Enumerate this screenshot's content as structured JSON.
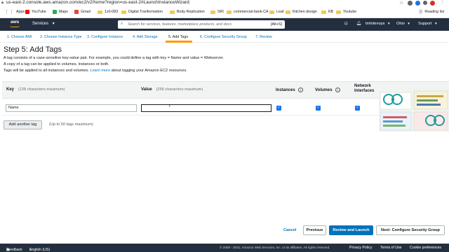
{
  "browser": {
    "url": "us-east-2.console.aws.amazon.com/ec2/v2/home?region=us-east-2#LaunchInstanceWizard:",
    "bookmarks": [
      {
        "label": "Apps",
        "icon": "apps-grid-icon",
        "color": "#5f6368"
      },
      {
        "label": "YouTube",
        "icon": "youtube-icon",
        "color": "#ff0000"
      },
      {
        "label": "Maps",
        "icon": "maps-icon",
        "color": "#34a853"
      },
      {
        "label": "Gmail",
        "icon": "gmail-icon",
        "color": "#ea4335"
      },
      {
        "label": "1z0-083",
        "icon": "folder-icon",
        "color": "#f2c94c"
      },
      {
        "label": "Digital Tranformation",
        "icon": "folder-icon",
        "color": "#f2c94c"
      },
      {
        "label": "Body Replication",
        "icon": "folder-icon",
        "color": "#f2c94c"
      },
      {
        "label": "SRI",
        "icon": "folder-icon",
        "color": "#f2c94c"
      },
      {
        "label": "commercial-bank-CA",
        "icon": "folder-icon",
        "color": "#f2c94c"
      },
      {
        "label": "Leaf",
        "icon": "folder-icon",
        "color": "#f2c94c"
      },
      {
        "label": "Kitchen design",
        "icon": "folder-icon",
        "color": "#f2c94c"
      },
      {
        "label": "KB",
        "icon": "folder-icon",
        "color": "#f2c94c"
      },
      {
        "label": "Youtube",
        "icon": "folder-icon",
        "color": "#f2c94c"
      }
    ],
    "reading_list": "Reading list"
  },
  "nav": {
    "logo": "aws",
    "services": "Services",
    "search_placeholder": "Search for services, features, marketplace products, and docs",
    "search_shortcut": "[Alt+S]",
    "user": "tmhdevops",
    "region": "Ohio",
    "support": "Support"
  },
  "wizard": {
    "steps": [
      "1. Choose AMI",
      "2. Choose Instance Type",
      "3. Configure Instance",
      "4. Add Storage",
      "5. Add Tags",
      "6. Configure Security Group",
      "7. Review"
    ],
    "active_step": 4
  },
  "page": {
    "title": "Step 5: Add Tags",
    "desc1": "A tag consists of a case-sensitive key-value pair. For example, you could define a tag with key = Name and value = Webserver.",
    "desc2": "A copy of a tag can be applied to volumes, instances or both.",
    "desc3_prefix": "Tags will be applied to all instances and volumes.",
    "desc3_link": "Learn more",
    "desc3_suffix": "about tagging your Amazon EC2 resources."
  },
  "table": {
    "key_header": "Key",
    "key_hint": "(128 characters maximum)",
    "value_header": "Value",
    "value_hint": "(256 characters maximum)",
    "instances_header": "Instances",
    "volumes_header": "Volumes",
    "network_header_1": "Network",
    "network_header_2": "Interfaces",
    "row": {
      "key": "Name",
      "value": "",
      "instances": true,
      "volumes": true,
      "network_interfaces": true
    }
  },
  "actions": {
    "add_tag": "Add another tag",
    "add_tag_hint": "(Up to 50 tags maximum)",
    "cancel": "Cancel",
    "previous": "Previous",
    "review_launch": "Review and Launch",
    "next": "Next: Configure Security Group"
  },
  "footer": {
    "feedback": "Feedback",
    "language": "English (US)",
    "copyright": "© 2008 - 2021, Amazon Web Services, Inc. or its affiliates. All rights reserved.",
    "privacy": "Privacy Policy",
    "terms": "Terms of Use",
    "cookies": "Cookie preferences"
  },
  "colors": {
    "aws_nav": "#232f3e",
    "accent_orange": "#ff9900",
    "link_blue": "#0073bb",
    "checkbox_blue": "#1a73e8"
  }
}
